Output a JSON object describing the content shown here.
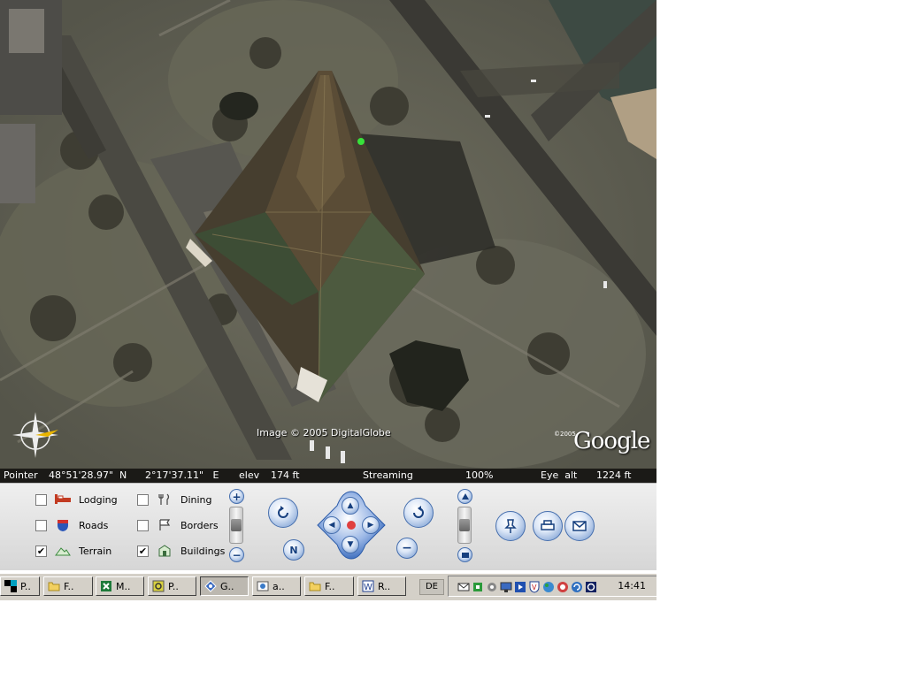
{
  "map": {
    "copyright": "Image © 2005 DigitalGlobe",
    "logo_copyright": "©2005",
    "logo": "Google"
  },
  "status": {
    "pointer_label": "Pointer",
    "lat": "48°51'28.97\"  N",
    "lon": "2°17'37.11\"   E",
    "elev_label": "elev",
    "elev": "174 ft",
    "streaming_label": "Streaming",
    "streaming_value": "100%",
    "streaming_fraction": 1.0,
    "eye_alt_label": "Eye  alt",
    "eye_alt": "1224 ft"
  },
  "layers": [
    {
      "label": "Lodging",
      "checked": false,
      "icon": "bed-icon"
    },
    {
      "label": "Roads",
      "checked": false,
      "icon": "highway-shield-icon"
    },
    {
      "label": "Terrain",
      "checked": true,
      "icon": "terrain-icon"
    },
    {
      "label": "Dining",
      "checked": false,
      "icon": "fork-knife-icon"
    },
    {
      "label": "Borders",
      "checked": false,
      "icon": "flag-icon"
    },
    {
      "label": "Buildings",
      "checked": true,
      "icon": "building-icon"
    }
  ],
  "checks": {
    "on": "✔",
    "off": ""
  },
  "controls": {
    "zoom_in": "+",
    "zoom_out": "−",
    "north": "N",
    "zoom_level": 0.5,
    "tilt_level": 0.5
  },
  "taskbar": {
    "tasks": [
      {
        "label": "P..",
        "icon": "start-icon"
      },
      {
        "label": "F..",
        "icon": "folder-icon"
      },
      {
        "label": "M..",
        "icon": "excel-icon"
      },
      {
        "label": "P..",
        "icon": "app-icon"
      },
      {
        "label": "G..",
        "icon": "google-earth-icon"
      },
      {
        "label": "a..",
        "icon": "browser-icon"
      },
      {
        "label": "F..",
        "icon": "folder-icon"
      },
      {
        "label": "R..",
        "icon": "word-icon"
      }
    ],
    "language": "DE",
    "clock": "14:41"
  }
}
